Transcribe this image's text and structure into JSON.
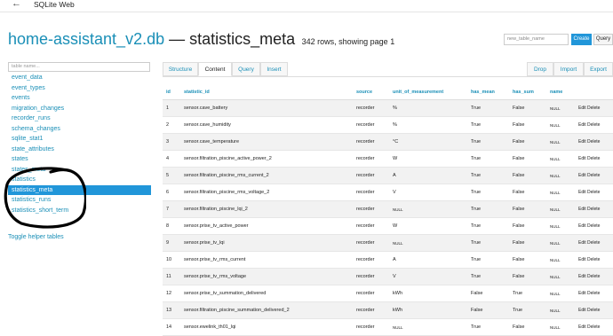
{
  "app": {
    "title": "SQLite Web",
    "back_icon": "arrow-left-icon"
  },
  "header": {
    "db_name": "home-assistant_v2.db",
    "separator": " — ",
    "table_name": "statistics_meta",
    "rows_info": "342 rows, showing page 1"
  },
  "toolbar": {
    "new_table_placeholder": "new_table_name",
    "create_label": "Create",
    "query_label": "Query"
  },
  "sidebar": {
    "search_placeholder": "table name...",
    "items": [
      {
        "label": "event_data"
      },
      {
        "label": "event_types"
      },
      {
        "label": "events"
      },
      {
        "label": "migration_changes"
      },
      {
        "label": "recorder_runs"
      },
      {
        "label": "schema_changes"
      },
      {
        "label": "sqlite_stat1"
      },
      {
        "label": "state_attributes"
      },
      {
        "label": "states"
      },
      {
        "label": "states_meta"
      },
      {
        "label": "statistics"
      },
      {
        "label": "statistics_meta",
        "active": true
      },
      {
        "label": "statistics_runs"
      },
      {
        "label": "statistics_short_term"
      }
    ],
    "toggle_label": "Toggle helper tables"
  },
  "tabs": {
    "left": [
      "Structure",
      "Content",
      "Query",
      "Insert"
    ],
    "active": "Content",
    "right": [
      "Drop",
      "Import",
      "Export"
    ]
  },
  "table": {
    "columns": [
      "id",
      "statistic_id",
      "source",
      "unit_of_measurement",
      "has_mean",
      "has_sum",
      "name",
      ""
    ],
    "rows": [
      [
        "1",
        "sensor.cave_battery",
        "recorder",
        "%",
        "True",
        "False",
        "NULL",
        "Edit Delete"
      ],
      [
        "2",
        "sensor.cave_humidity",
        "recorder",
        "%",
        "True",
        "False",
        "NULL",
        "Edit Delete"
      ],
      [
        "3",
        "sensor.cave_temperature",
        "recorder",
        "°C",
        "True",
        "False",
        "NULL",
        "Edit Delete"
      ],
      [
        "4",
        "sensor.filtration_piscine_active_power_2",
        "recorder",
        "W",
        "True",
        "False",
        "NULL",
        "Edit Delete"
      ],
      [
        "5",
        "sensor.filtration_piscine_rms_current_2",
        "recorder",
        "A",
        "True",
        "False",
        "NULL",
        "Edit Delete"
      ],
      [
        "6",
        "sensor.filtration_piscine_rms_voltage_2",
        "recorder",
        "V",
        "True",
        "False",
        "NULL",
        "Edit Delete"
      ],
      [
        "7",
        "sensor.filtration_piscine_lqi_2",
        "recorder",
        "NULL",
        "True",
        "False",
        "NULL",
        "Edit Delete"
      ],
      [
        "8",
        "sensor.prise_tv_active_power",
        "recorder",
        "W",
        "True",
        "False",
        "NULL",
        "Edit Delete"
      ],
      [
        "9",
        "sensor.prise_tv_lqi",
        "recorder",
        "NULL",
        "True",
        "False",
        "NULL",
        "Edit Delete"
      ],
      [
        "10",
        "sensor.prise_tv_rms_current",
        "recorder",
        "A",
        "True",
        "False",
        "NULL",
        "Edit Delete"
      ],
      [
        "11",
        "sensor.prise_tv_rms_voltage",
        "recorder",
        "V",
        "True",
        "False",
        "NULL",
        "Edit Delete"
      ],
      [
        "12",
        "sensor.prise_tv_summation_delivered",
        "recorder",
        "kWh",
        "False",
        "True",
        "NULL",
        "Edit Delete"
      ],
      [
        "13",
        "sensor.filtration_piscine_summation_delivered_2",
        "recorder",
        "kWh",
        "False",
        "True",
        "NULL",
        "Edit Delete"
      ],
      [
        "14",
        "sensor.ewelink_th01_lqi",
        "recorder",
        "NULL",
        "True",
        "False",
        "NULL",
        "Edit Delete"
      ]
    ]
  }
}
